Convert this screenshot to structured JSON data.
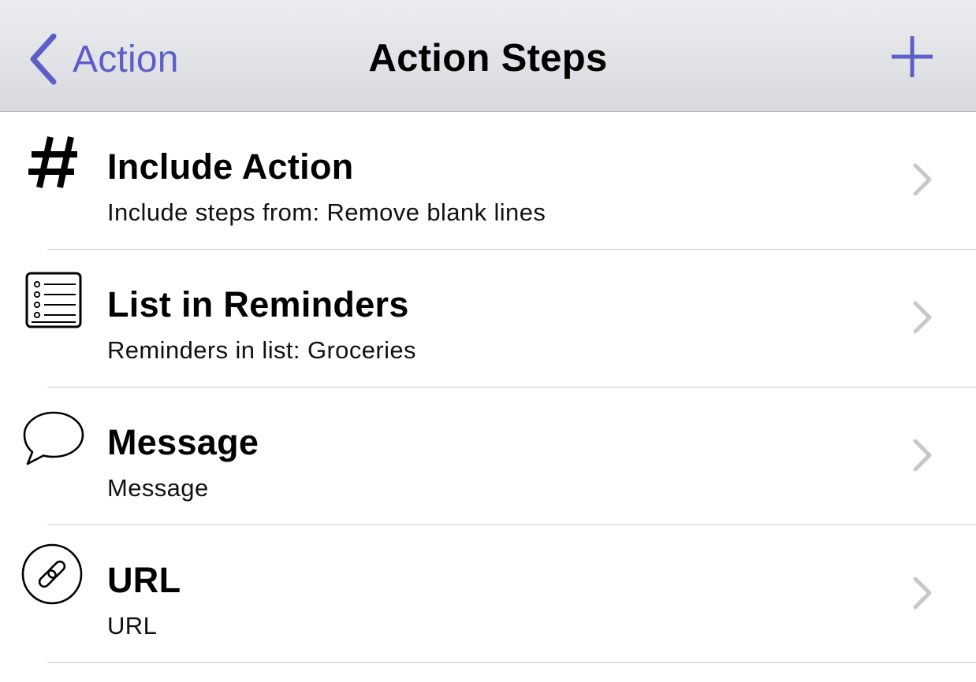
{
  "navbar": {
    "back_label": "Action",
    "title": "Action Steps",
    "back_icon": "chevron-left-icon",
    "add_icon": "plus-icon"
  },
  "steps": [
    {
      "title": "Include Action",
      "subtitle": "Include steps from: Remove blank lines",
      "icon": "hash-icon"
    },
    {
      "title": "List in Reminders",
      "subtitle": "Reminders in list: Groceries",
      "icon": "list-icon"
    },
    {
      "title": "Message",
      "subtitle": "Message",
      "icon": "speech-bubble-icon"
    },
    {
      "title": "URL",
      "subtitle": "URL",
      "icon": "link-icon"
    }
  ],
  "colors": {
    "accent": "#5b5fc7",
    "navbar_bg": "#dcdde2",
    "chevron": "#c7c7cc",
    "separator": "#c9c9cc"
  }
}
